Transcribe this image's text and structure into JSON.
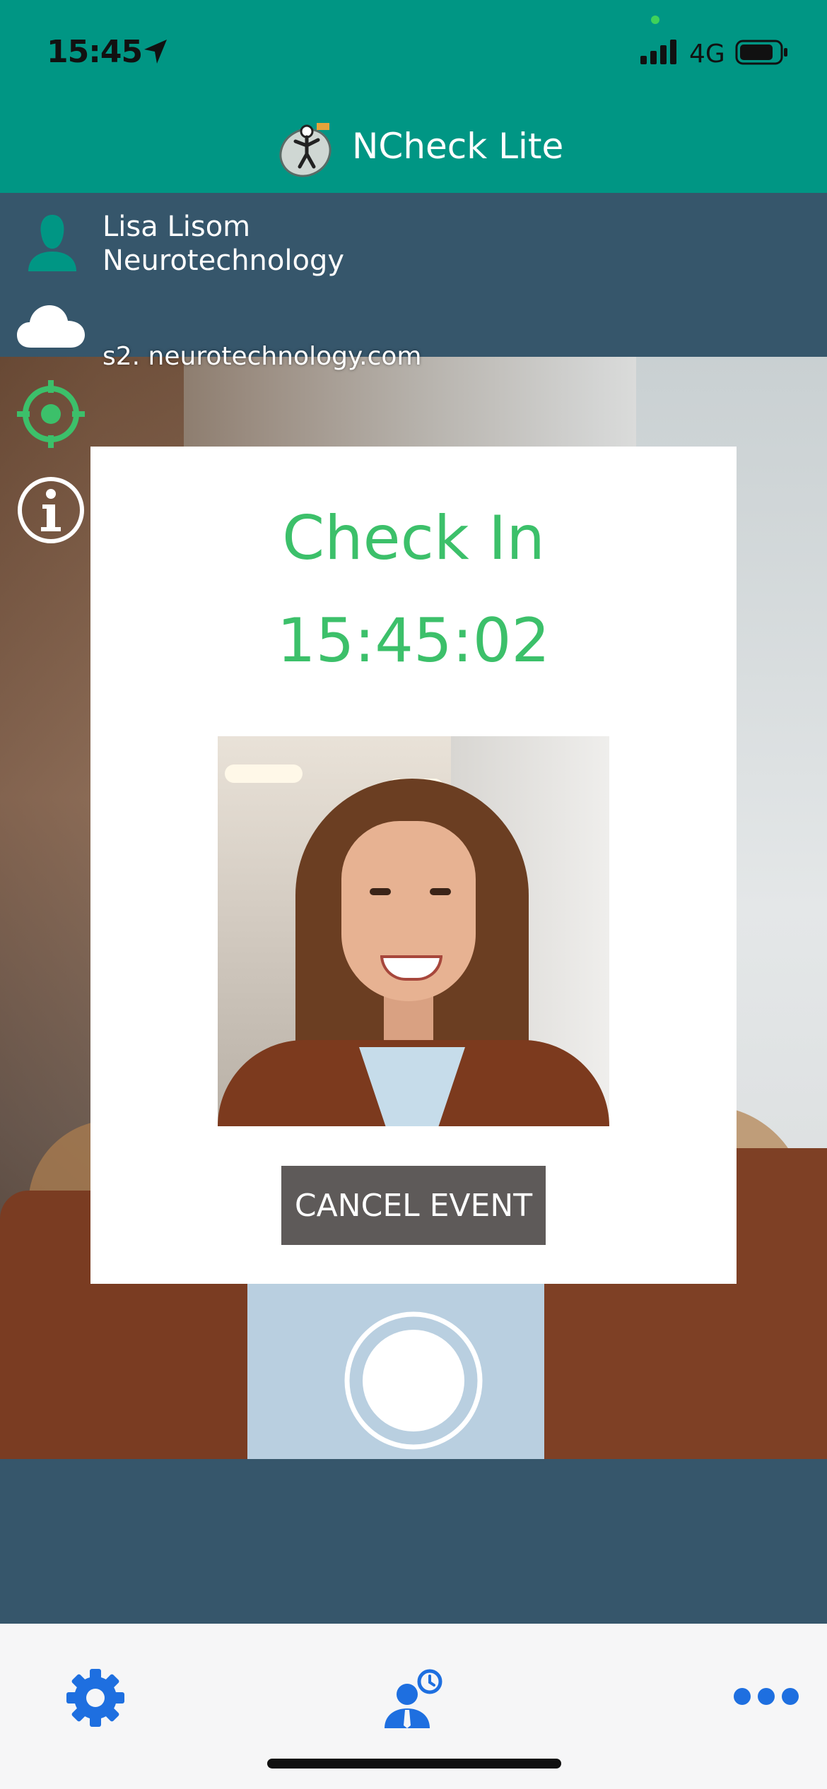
{
  "status_bar": {
    "time": "15:45",
    "network": "4G"
  },
  "header": {
    "title": "NCheck Lite"
  },
  "info": {
    "user_name": "Lisa Lisom",
    "organization": "Neurotechnology",
    "server": "s2. neurotechnology.com"
  },
  "dialog": {
    "title": "Check In",
    "time": "15:45:02",
    "cancel_label": "CANCEL EVENT"
  },
  "colors": {
    "header_bg": "#009684",
    "panel_bg": "#36566b",
    "accent_green": "#3cc06a",
    "tab_icon_blue": "#1e6fe0",
    "button_bg": "#5e5a59"
  },
  "tab_bar": {
    "items": [
      {
        "icon": "gear-icon"
      },
      {
        "icon": "attendance-icon"
      },
      {
        "icon": "more-icon"
      }
    ]
  }
}
